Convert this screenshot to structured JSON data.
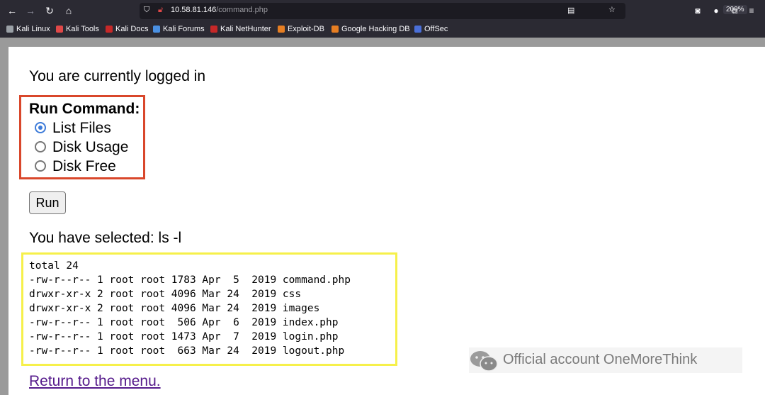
{
  "browser": {
    "url_host": "10.58.81.146",
    "url_path": "/command.php",
    "zoom": "200%",
    "bookmarks": [
      {
        "label": "Kali Linux",
        "color": "#9aa0a6"
      },
      {
        "label": "Kali Tools",
        "color": "#e04848"
      },
      {
        "label": "Kali Docs",
        "color": "#c62828"
      },
      {
        "label": "Kali Forums",
        "color": "#4a90e2"
      },
      {
        "label": "Kali NetHunter",
        "color": "#c62828"
      },
      {
        "label": "Exploit-DB",
        "color": "#e67e22"
      },
      {
        "label": "Google Hacking DB",
        "color": "#e67e22"
      },
      {
        "label": "OffSec",
        "color": "#4a6fd8"
      }
    ]
  },
  "page": {
    "logged_in": "You are currently logged in",
    "run_command": "Run Command:",
    "options": [
      "List Files",
      "Disk Usage",
      "Disk Free"
    ],
    "selected_option": "List Files",
    "run_button": "Run",
    "selected_text": "You have selected: ls -l",
    "output": "total 24\n-rw-r--r-- 1 root root 1783 Apr  5  2019 command.php\ndrwxr-xr-x 2 root root 4096 Mar 24  2019 css\ndrwxr-xr-x 2 root root 4096 Mar 24  2019 images\n-rw-r--r-- 1 root root  506 Apr  6  2019 index.php\n-rw-r--r-- 1 root root 1473 Apr  7  2019 login.php\n-rw-r--r-- 1 root root  663 Mar 24  2019 logout.php",
    "return_link": "Return to the menu."
  },
  "annotations": {
    "red_box_color": "#d9472b",
    "yellow_box_color": "#f6f04a"
  },
  "watermark": "Official account OneMoreThink"
}
